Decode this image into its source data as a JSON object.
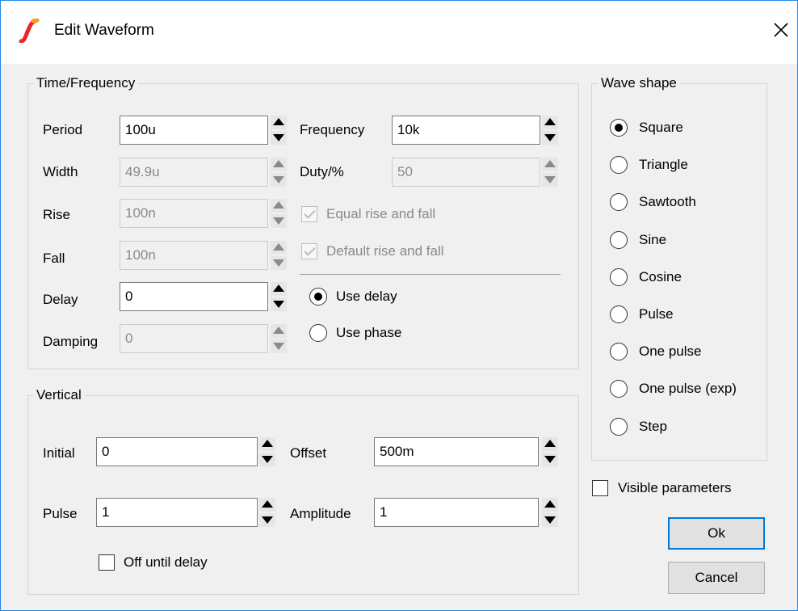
{
  "window": {
    "title": "Edit Waveform",
    "icon": "ltspice-app-icon",
    "close_icon": "close-icon",
    "accent": "#0078d7"
  },
  "time_group": {
    "legend": "Time/Frequency",
    "period": {
      "label": "Period",
      "value": "100u"
    },
    "width": {
      "label": "Width",
      "value": "49.9u"
    },
    "rise": {
      "label": "Rise",
      "value": "100n"
    },
    "fall": {
      "label": "Fall",
      "value": "100n"
    },
    "delay": {
      "label": "Delay",
      "value": "0"
    },
    "damping": {
      "label": "Damping",
      "value": "0"
    },
    "frequency": {
      "label": "Frequency",
      "value": "10k"
    },
    "duty": {
      "label": "Duty/%",
      "value": "50"
    },
    "equal_rise_fall": {
      "label": "Equal rise and fall",
      "checked": true
    },
    "default_rise_fall": {
      "label": "Default rise and fall",
      "checked": true
    },
    "use_delay": {
      "label": "Use delay",
      "selected": true
    },
    "use_phase": {
      "label": "Use phase",
      "selected": false
    }
  },
  "vertical_group": {
    "legend": "Vertical",
    "initial": {
      "label": "Initial",
      "value": "0"
    },
    "offset": {
      "label": "Offset",
      "value": "500m"
    },
    "pulse": {
      "label": "Pulse",
      "value": "1"
    },
    "amplitude": {
      "label": "Amplitude",
      "value": "1"
    },
    "off_until_delay": {
      "label": "Off until delay",
      "checked": false
    }
  },
  "wave_shape": {
    "legend": "Wave shape",
    "selected": "Square",
    "options": [
      "Square",
      "Triangle",
      "Sawtooth",
      "Sine",
      "Cosine",
      "Pulse",
      "One pulse",
      "One pulse (exp)",
      "Step"
    ]
  },
  "visible_parameters": {
    "label": "Visible parameters",
    "checked": false
  },
  "buttons": {
    "ok": "Ok",
    "cancel": "Cancel"
  }
}
